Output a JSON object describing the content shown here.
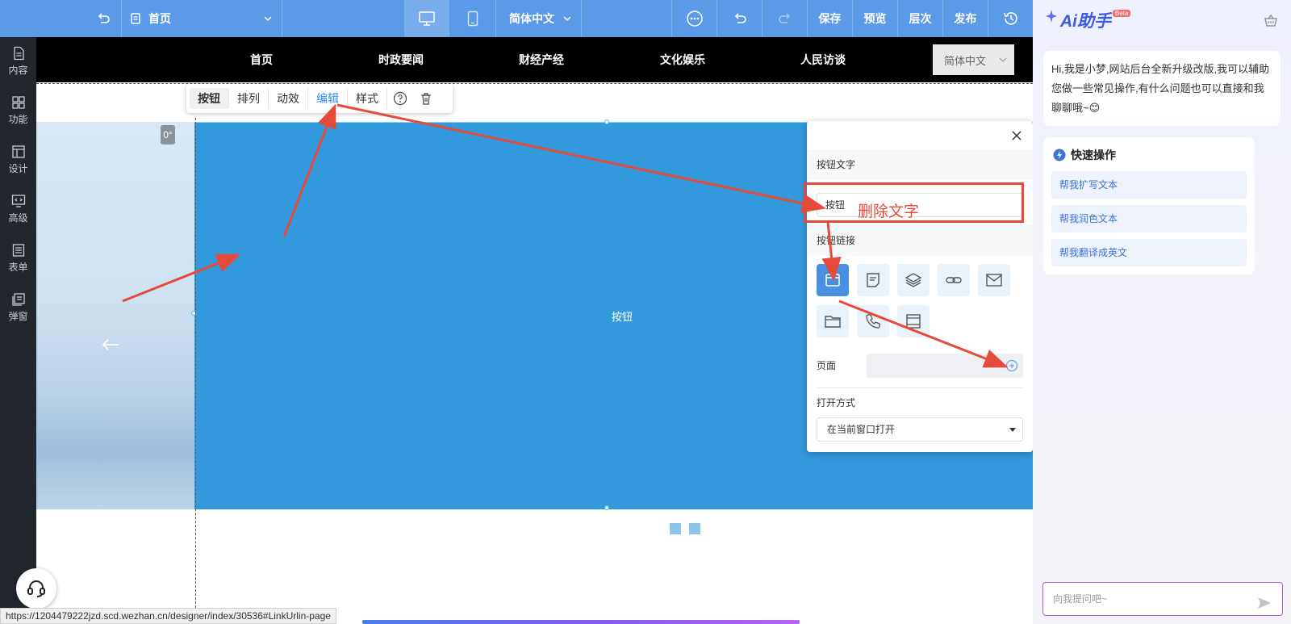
{
  "toolbar": {
    "page_select": "首页",
    "language": "简体中文",
    "save": "保存",
    "preview": "预览",
    "layers": "层次",
    "publish": "发布"
  },
  "sidebar": {
    "items": [
      {
        "label": "内容",
        "icon": "document-icon"
      },
      {
        "label": "功能",
        "icon": "grid-icon"
      },
      {
        "label": "设计",
        "icon": "layout-icon"
      },
      {
        "label": "高级",
        "icon": "code-monitor-icon"
      },
      {
        "label": "表单",
        "icon": "form-icon"
      },
      {
        "label": "弹窗",
        "icon": "popup-icon"
      }
    ]
  },
  "site_nav": {
    "items": [
      "首页",
      "时政要闻",
      "财经产经",
      "文化娱乐",
      "人民访谈"
    ],
    "language": "简体中文"
  },
  "canvas": {
    "rotation_badge": "0°",
    "button_text": "按钮"
  },
  "element_toolbar": {
    "tabs": [
      "按钮",
      "排列",
      "动效",
      "编辑",
      "样式"
    ],
    "active_tab": "编辑"
  },
  "panel": {
    "button_text_label": "按钮文字",
    "button_text_value": "按钮",
    "button_link_label": "按钮链接",
    "page_label": "页面",
    "open_mode_label": "打开方式",
    "open_mode_value": "在当前窗口打开"
  },
  "annotation": {
    "text": "删除文字",
    "color": "#e64a3b"
  },
  "status_url": "https://1204479222jzd.scd.wezhan.cn/designer/index/30536#LinkUrlin-page",
  "ai": {
    "logo": "Ai助手",
    "beta": "Beta",
    "greeting": "Hi,我是小梦,网站后台全新升级改版,我可以辅助您做一些常见操作,有什么问题也可以直接和我聊聊哦~😊",
    "quick_title": "快速操作",
    "quick_actions": [
      "帮我扩写文本",
      "帮我润色文本",
      "帮我翻译成英文"
    ],
    "input_placeholder": "向我提问吧~"
  },
  "colors": {
    "toolbar_bg": "#5b9ae6",
    "sidebar_bg": "#22272e",
    "slide_blue": "#3399dd",
    "accent": "#2d8cf0"
  }
}
